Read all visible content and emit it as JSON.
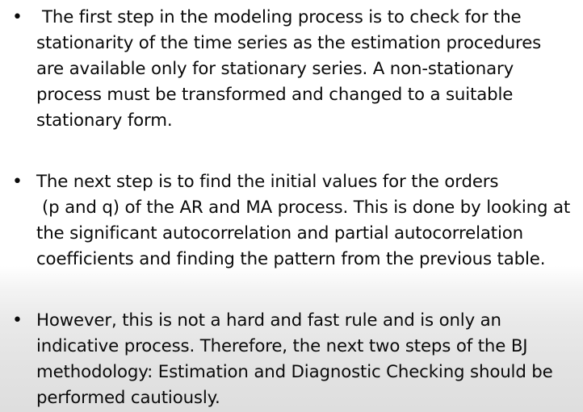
{
  "bullets": [
    {
      "lines": [
        " The first step in the modeling process is to check for the",
        "stationarity of the time series as the estimation procedures",
        "are available only for stationary series. A non-stationary",
        "process must be transformed and changed to a suitable",
        "stationary form."
      ]
    },
    {
      "lines": [
        "The next step is to find the initial values for the orders",
        " (p and q) of the AR and MA process. This is done by looking at",
        "the significant autocorrelation and partial autocorrelation",
        "coefficients and finding the pattern from the previous table."
      ]
    },
    {
      "lines": [
        "However, this is not a hard and fast rule and is only an",
        "indicative process. Therefore, the next two steps of the BJ",
        "methodology: Estimation and Diagnostic Checking should be",
        "performed cautiously."
      ]
    }
  ],
  "bullet_symbol": "•"
}
